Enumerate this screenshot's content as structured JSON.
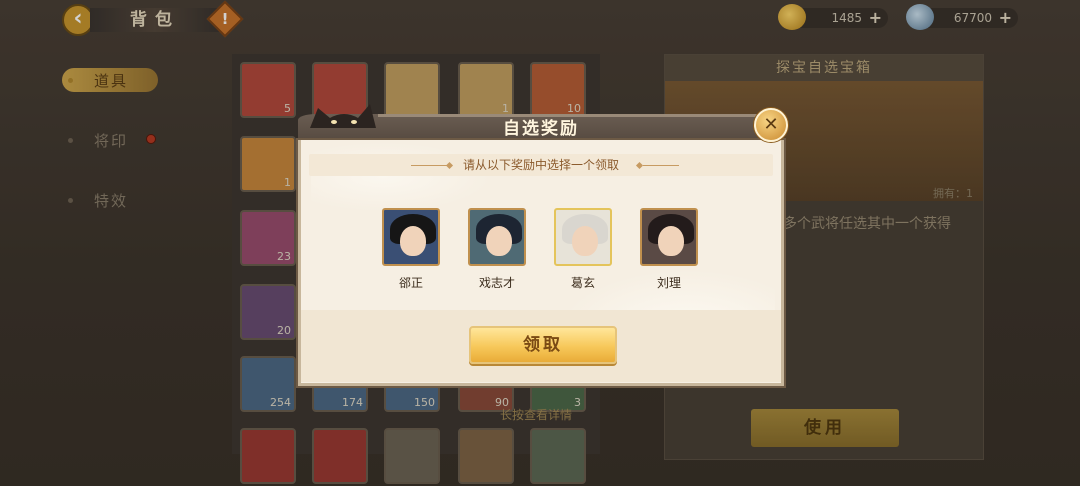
{
  "header": {
    "title": "背包",
    "back_icon": "back-arrow-icon",
    "help_label": "!"
  },
  "currencies": [
    {
      "icon": "gold-ingot-icon",
      "value": "1485"
    },
    {
      "icon": "silver-ingot-icon",
      "value": "67700"
    }
  ],
  "sidebar": {
    "items": [
      {
        "label": "道具",
        "active": true
      },
      {
        "label": "将印",
        "badge": true
      },
      {
        "label": "特效"
      }
    ]
  },
  "inventory": {
    "counts": [
      "5",
      "",
      "",
      "1",
      "10",
      "1",
      "23",
      "20",
      "254",
      "174",
      "150",
      "90",
      "3"
    ],
    "hint": "长按查看详情"
  },
  "detail_panel": {
    "title": "探宝自选宝箱",
    "owned": "拥有：1",
    "description": "多个武将任选其中一个获得",
    "use_label": "使用"
  },
  "modal": {
    "title": "自选奖励",
    "subtitle": "请从以下奖励中选择一个领取",
    "heroes": [
      {
        "name": "郤正",
        "frame": "orange"
      },
      {
        "name": "戏志才",
        "frame": "orange"
      },
      {
        "name": "葛玄",
        "frame": "gold"
      },
      {
        "name": "刘理",
        "frame": "orange"
      }
    ],
    "claim_label": "领取",
    "close_icon": "close-icon"
  },
  "colors": {
    "accent_gold": "#f7c85a",
    "modal_bg": "#f6efe3",
    "header_bg": "#54483e",
    "text_brown": "#8b5a2c"
  }
}
